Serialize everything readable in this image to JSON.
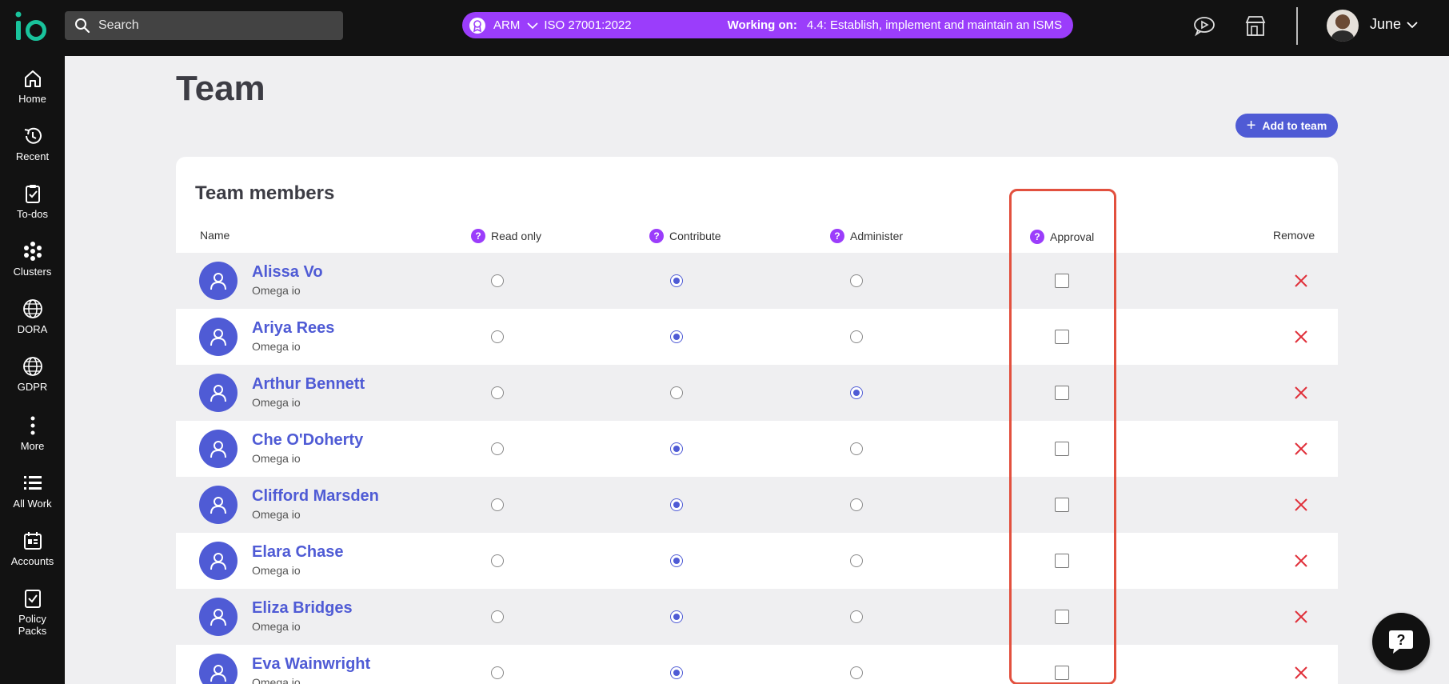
{
  "topbar": {
    "search_placeholder": "Search",
    "context": {
      "framework_short": "ARM",
      "standard": "ISO 27001:2022",
      "working_on_label": "Working on:",
      "working_on_value": "4.4: Establish, implement and maintain an ISMS"
    },
    "user_name": "June"
  },
  "nav": [
    {
      "label": "Home",
      "icon": "home-icon"
    },
    {
      "label": "Recent",
      "icon": "history-icon"
    },
    {
      "label": "To-dos",
      "icon": "clipboard-check-icon"
    },
    {
      "label": "Clusters",
      "icon": "clusters-icon"
    },
    {
      "label": "DORA",
      "icon": "globe-icon"
    },
    {
      "label": "GDPR",
      "icon": "globe-icon"
    },
    {
      "label": "More",
      "icon": "more-vertical-icon"
    },
    {
      "label": "All Work",
      "icon": "list-icon"
    },
    {
      "label": "Accounts",
      "icon": "accounts-icon"
    },
    {
      "label": "Policy Packs",
      "icon": "policy-pack-icon"
    }
  ],
  "page": {
    "title": "Team",
    "add_button": "Add to team"
  },
  "table": {
    "title": "Team members",
    "columns": {
      "name": "Name",
      "read_only": "Read only",
      "contribute": "Contribute",
      "administer": "Administer",
      "approval": "Approval",
      "remove": "Remove"
    },
    "rows": [
      {
        "name": "Alissa Vo",
        "org": "Omega io",
        "role": "contribute",
        "approval": false
      },
      {
        "name": "Ariya Rees",
        "org": "Omega io",
        "role": "contribute",
        "approval": false
      },
      {
        "name": "Arthur Bennett",
        "org": "Omega io",
        "role": "administer",
        "approval": false
      },
      {
        "name": "Che O'Doherty",
        "org": "Omega io",
        "role": "contribute",
        "approval": false
      },
      {
        "name": "Clifford Marsden",
        "org": "Omega io",
        "role": "contribute",
        "approval": false
      },
      {
        "name": "Elara Chase",
        "org": "Omega io",
        "role": "contribute",
        "approval": false
      },
      {
        "name": "Eliza Bridges",
        "org": "Omega io",
        "role": "contribute",
        "approval": false
      },
      {
        "name": "Eva Wainwright",
        "org": "Omega io",
        "role": "contribute",
        "approval": false
      }
    ]
  },
  "colors": {
    "accent": "#4f5bd5",
    "purple": "#9b3dfb",
    "remove": "#e0303a",
    "highlight": "#e2503e"
  }
}
